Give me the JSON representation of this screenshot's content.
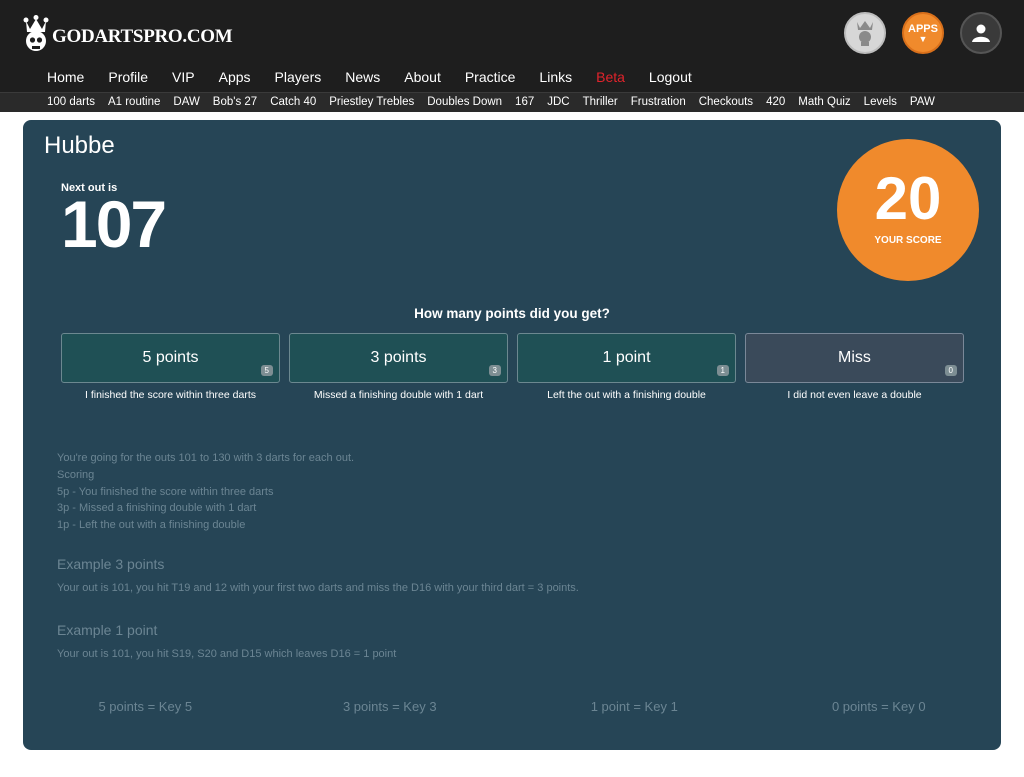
{
  "site": {
    "logo_text": "GODARTSPRO.COM",
    "apps_label": "APPS"
  },
  "mainnav": [
    "Home",
    "Profile",
    "VIP",
    "Apps",
    "Players",
    "News",
    "About",
    "Practice",
    "Links",
    "Beta",
    "Logout"
  ],
  "subnav": [
    "100 darts",
    "A1 routine",
    "DAW",
    "Bob's 27",
    "Catch 40",
    "Priestley Trebles",
    "Doubles Down",
    "167",
    "JDC",
    "Thriller",
    "Frustration",
    "Checkouts",
    "420",
    "Math Quiz",
    "Levels",
    "PAW"
  ],
  "game": {
    "player": "Hubbe",
    "next_label": "Next out is",
    "next_value": "107",
    "score_value": "20",
    "score_label": "YOUR SCORE",
    "question": "How many points did you get?"
  },
  "options": [
    {
      "label": "5 points",
      "key": "5",
      "desc": "I finished the score within three darts"
    },
    {
      "label": "3 points",
      "key": "3",
      "desc": "Missed a finishing double with 1 dart"
    },
    {
      "label": "1 point",
      "key": "1",
      "desc": "Left the out with a finishing double"
    },
    {
      "label": "Miss",
      "key": "0",
      "desc": "I did not even leave a double"
    }
  ],
  "info": {
    "lines": [
      "You're going for the outs 101 to 130 with 3 darts for each out.",
      "Scoring",
      "5p - You finished the score within three darts",
      "3p - Missed a finishing double with 1 dart",
      "1p - Left the out with a finishing double"
    ],
    "example3_head": "Example 3 points",
    "example3_text": "Your out is 101, you hit T19 and 12 with your first two darts and miss the D16 with your third dart = 3 points.",
    "example1_head": "Example 1 point",
    "example1_text": "Your out is 101, you hit S19, S20 and D15 which leaves D16 = 1 point"
  },
  "keys": [
    "5 points = Key 5",
    "3 points = Key 3",
    "1 point = Key 1",
    "0 points = Key 0"
  ],
  "colors": {
    "panel": "#264556",
    "accent": "#f08a2c",
    "beta": "#e0232b",
    "topbar": "#1e1e1e"
  }
}
